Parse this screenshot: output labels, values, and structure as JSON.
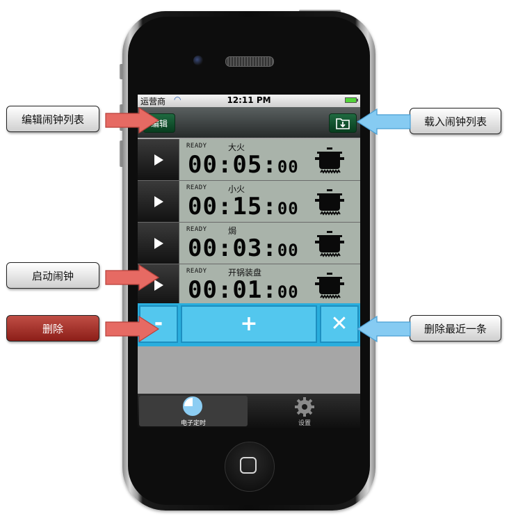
{
  "status_bar": {
    "carrier": "运营商",
    "time": "12:11 PM"
  },
  "nav": {
    "edit_label": "编辑",
    "load_icon": "folder-download-icon"
  },
  "timers": [
    {
      "status": "READY",
      "name": "大火",
      "time": "00:05:",
      "seconds": "00",
      "icon": "pot-icon"
    },
    {
      "status": "READY",
      "name": "小火",
      "time": "00:15:",
      "seconds": "00",
      "icon": "pot-icon"
    },
    {
      "status": "READY",
      "name": "焗",
      "time": "00:03:",
      "seconds": "00",
      "icon": "pot-icon"
    },
    {
      "status": "READY",
      "name": "开锅装盘",
      "time": "00:01:",
      "seconds": "00",
      "icon": "pot-icon"
    }
  ],
  "controls": {
    "minus_label": "-",
    "plus_label": "+",
    "clear_label": "✕"
  },
  "tabs": [
    {
      "label": "电子定时",
      "icon": "timer-pie-icon",
      "selected": true
    },
    {
      "label": "设置",
      "icon": "gear-icon",
      "selected": false
    }
  ],
  "callouts": {
    "edit_list": "编辑闹钟列表",
    "load_list": "载入闹钟列表",
    "start_alarm": "启动闹钟",
    "delete": "删除",
    "delete_last": "删除最近一条"
  },
  "colors": {
    "accent_blue": "#53c7ee",
    "arrow_red": "#e25b57",
    "arrow_blue": "#7cc4ef",
    "nav_green": "#1f6a40"
  }
}
